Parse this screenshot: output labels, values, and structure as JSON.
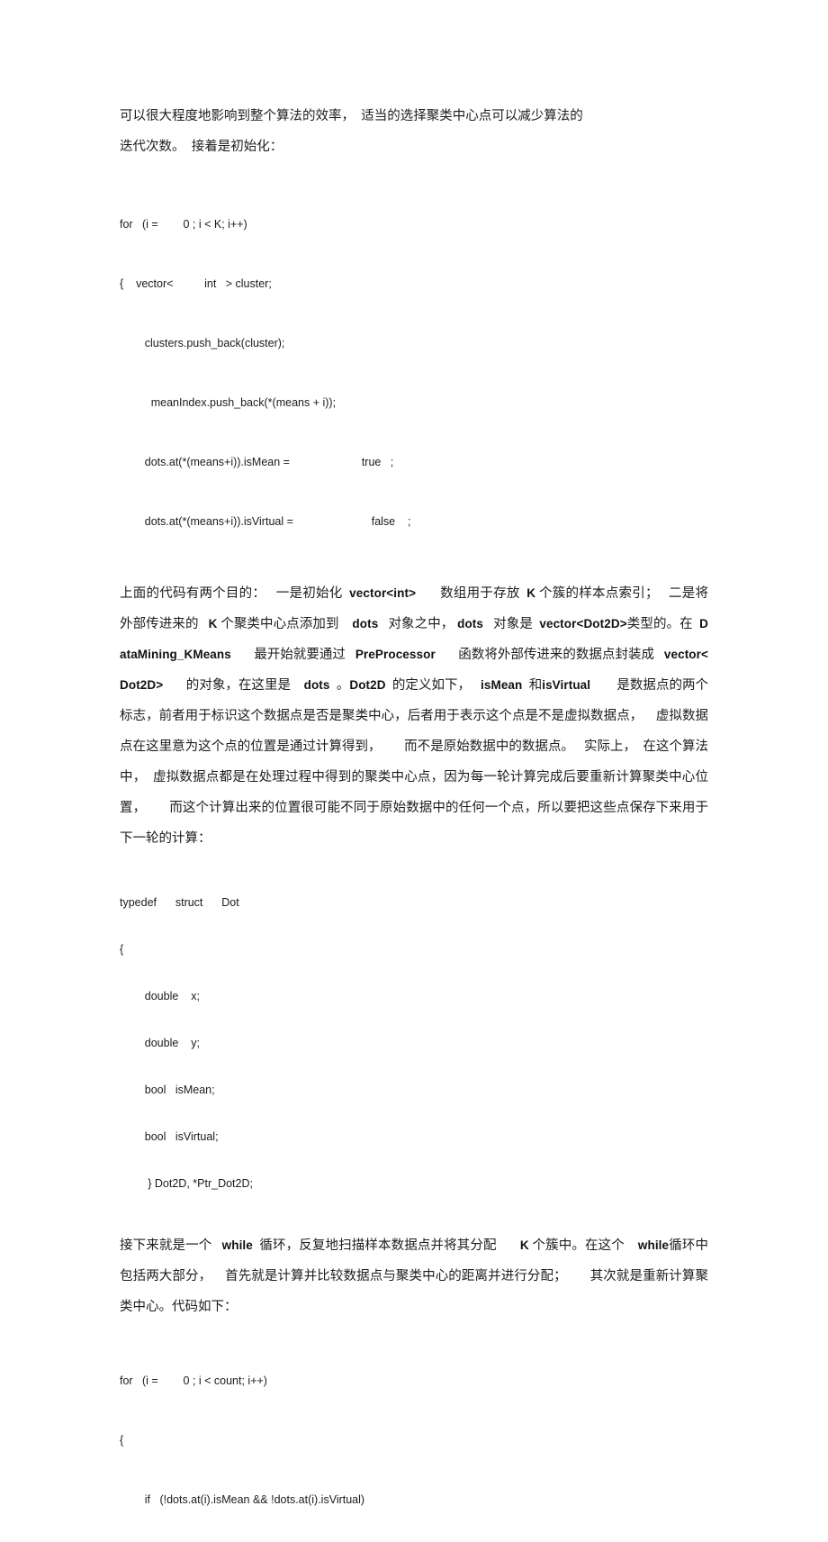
{
  "document": {
    "page_background": "#ffffff",
    "text_color": "#1c1c1c",
    "blocks": {
      "intro_paragraph": "可以很大程度地影响到整个算法的效率，  适当的选择聚类中心点可以减少算法的\n迭代次数。  接着是初始化：",
      "code_init": [
        "for   (i =        0 ; i < K; i++)",
        "{    vector<          int   > cluster;",
        "        clusters.push_back(cluster);",
        "          meanIndex.push_back(*(means + i));",
        "        dots.at(*(means+i)).isMean =                       true   ;",
        "        dots.at(*(means+i)).isVirtual =                         false    ;"
      ],
      "explain_paragraph_1": "上面的代码有两个目的：   一是初始化  vector<int>       数组用于存放  K 个簇的样本点索引；   二是将外部传进来的   K 个聚类中心点添加到    dots   对象之中， dots   对象是  vector<Dot2D>类型的。在  DataMining_KMeans       最开始就要通过   PreProcessor       函数将外部传进来的数据点封装成   vector<Dot2D>       的对象，在这里是    dots  。Dot2D  的定义如下，   isMean  和isVirtual        是数据点的两个标志，前者用于标识这个数据点是否是聚类中心，后者用于表示这个点是不是虚拟数据点，    虚拟数据点在这里意为这个点的位置是通过计算得到，       而不是原始数据中的数据点。   实际上，  在这个算法中，  虚拟数据点都是在处理过程中得到的聚类中心点，因为每一轮计算完成后要重新计算聚类中心位置，       而这个计算出来的位置很可能不同于原始数据中的任何一个点，所以要把这些点保存下来用于下一轮的计算：",
      "code_struct": [
        "typedef      struct      Dot",
        "{",
        "        double    x;",
        "        double    y;",
        "        bool   isMean;",
        "        bool   isVirtual;",
        "         } Dot2D, *Ptr_Dot2D;"
      ],
      "explain_paragraph_2": "接下来就是一个   while  循环，反复地扫描样本数据点并将其分配       K 个簇中。在这个    while循环中包括两大部分，    首先就是计算并比较数据点与聚类中心的距离并进行分配；       其次就是重新计算聚类中心。代码如下：",
      "code_loop": [
        "for   (i =        0 ; i < count; i++)",
        "{",
        "        if   (!dots.at(i).isMean && !dots.at(i).isVirtual)"
      ]
    }
  }
}
